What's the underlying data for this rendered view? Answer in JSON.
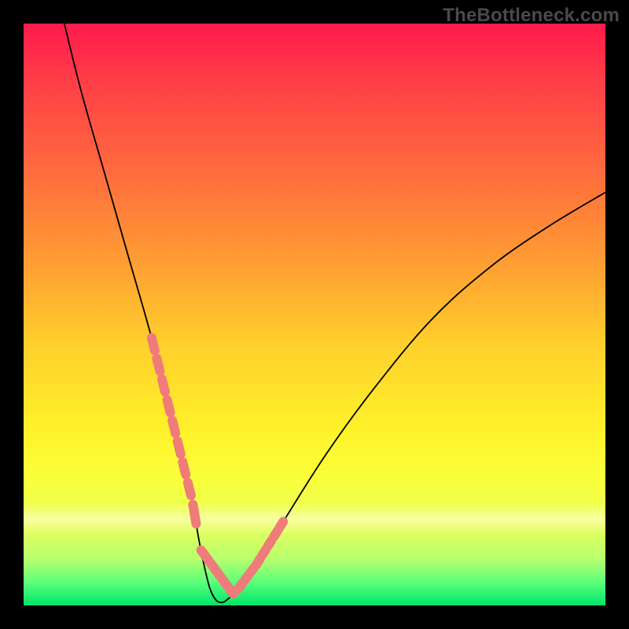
{
  "watermark": "TheBottleneck.com",
  "chart_data": {
    "type": "line",
    "title": "",
    "xlabel": "",
    "ylabel": "",
    "xlim": [
      0,
      100
    ],
    "ylim": [
      0,
      100
    ],
    "grid": false,
    "series": [
      {
        "name": "bottleneck-curve",
        "x": [
          7,
          10,
          14,
          18,
          22,
          25,
          27,
          29,
          30,
          31,
          32,
          33,
          34,
          35,
          37,
          40,
          45,
          52,
          60,
          70,
          80,
          90,
          100
        ],
        "y": [
          100,
          88,
          74,
          60,
          46,
          34,
          26,
          18,
          12,
          7,
          3,
          1,
          0.5,
          1,
          3,
          7,
          15,
          26,
          37,
          49,
          58,
          65,
          71
        ]
      }
    ],
    "highlight_segments": [
      {
        "name": "left-markers",
        "x_range": [
          22,
          30
        ],
        "note": "salmon dotted overlay on descending arm"
      },
      {
        "name": "right-markers",
        "x_range": [
          36,
          45
        ],
        "note": "salmon dotted overlay on ascending arm"
      }
    ],
    "trough": {
      "x": 33.5,
      "y": 0.3
    }
  },
  "colors": {
    "curve": "#000000",
    "marker": "#ef7b7b",
    "background_top": "#ff1a4a",
    "background_bottom": "#00e56a"
  }
}
